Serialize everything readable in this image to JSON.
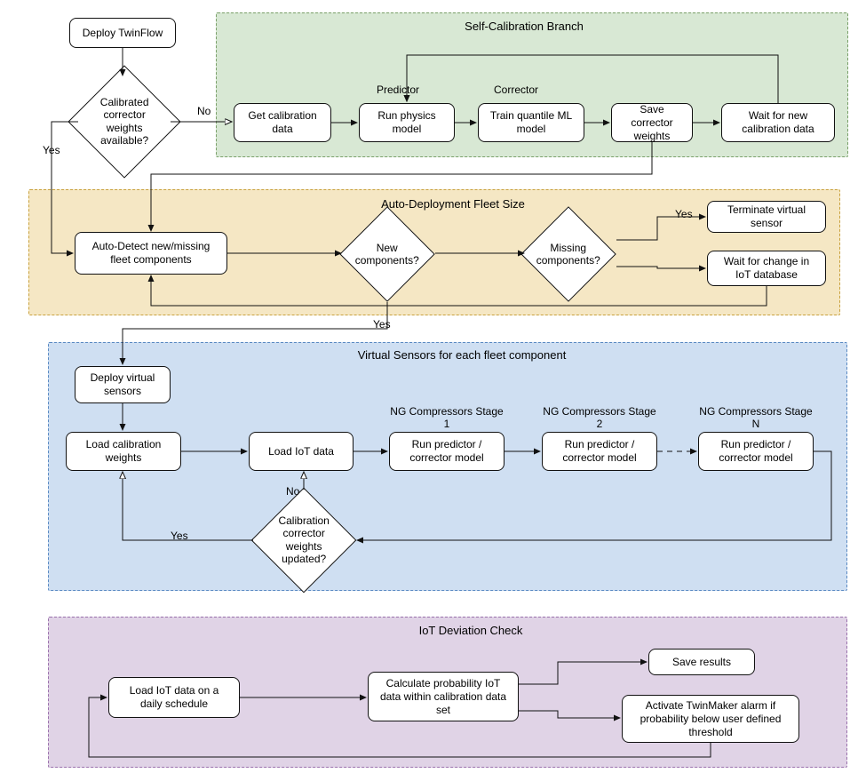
{
  "topflow": {
    "start": "Deploy TwinFlow",
    "decision": "Calibrated corrector weights available?",
    "yes_label": "Yes",
    "no_label": "No"
  },
  "green": {
    "title": "Self-Calibration Branch",
    "get_cal": "Get calibration data",
    "predictor_label": "Predictor",
    "run_phys": "Run physics model",
    "corrector_label": "Corrector",
    "train_ml": "Train quantile ML model",
    "save_w": "Save corrector weights",
    "wait_cal": "Wait for new calibration data"
  },
  "orange": {
    "title": "Auto-Deployment Fleet Size",
    "auto_detect": "Auto-Detect new/missing fleet components",
    "new_comp": "New components?",
    "miss_comp": "Missing components?",
    "terminate": "Terminate virtual sensor",
    "wait_change": "Wait for change in IoT database",
    "yes1": "Yes",
    "yes2": "Yes"
  },
  "blue": {
    "title": "Virtual Sensors for each fleet component",
    "deploy_vs": "Deploy virtual sensors",
    "load_cal": "Load calibration weights",
    "load_iot": "Load IoT data",
    "stage1_t": "NG Compressors Stage 1",
    "stage2_t": "NG Compressors Stage 2",
    "stageN_t": "NG Compressors Stage N",
    "run_pc": "Run predictor / corrector model",
    "cal_updated": "Calibration corrector weights updated?",
    "yes": "Yes",
    "no": "No"
  },
  "purple": {
    "title": "IoT Deviation Check",
    "load_iot_daily": "Load IoT data on a daily schedule",
    "calc_prob": "Calculate probability IoT data within calibration data set",
    "save_res": "Save results",
    "alarm": "Activate TwinMaker alarm if probability below user defined threshold"
  },
  "chart_data": {
    "type": "flowchart",
    "nodes": [
      {
        "id": "start",
        "kind": "process",
        "text": "Deploy TwinFlow",
        "region": null
      },
      {
        "id": "dec_cal",
        "kind": "decision",
        "text": "Calibrated corrector weights available?",
        "region": null
      },
      {
        "id": "g_get",
        "kind": "process",
        "text": "Get calibration data",
        "region": "Self-Calibration Branch"
      },
      {
        "id": "g_phys",
        "kind": "process",
        "text": "Run physics model",
        "annotation": "Predictor",
        "region": "Self-Calibration Branch"
      },
      {
        "id": "g_ml",
        "kind": "process",
        "text": "Train quantile ML model",
        "annotation": "Corrector",
        "region": "Self-Calibration Branch"
      },
      {
        "id": "g_save",
        "kind": "process",
        "text": "Save corrector weights",
        "region": "Self-Calibration Branch"
      },
      {
        "id": "g_wait",
        "kind": "process",
        "text": "Wait for new calibration data",
        "region": "Self-Calibration Branch"
      },
      {
        "id": "o_detect",
        "kind": "process",
        "text": "Auto-Detect new/missing fleet components",
        "region": "Auto-Deployment Fleet Size"
      },
      {
        "id": "o_new",
        "kind": "decision",
        "text": "New components?",
        "region": "Auto-Deployment Fleet Size"
      },
      {
        "id": "o_miss",
        "kind": "decision",
        "text": "Missing components?",
        "region": "Auto-Deployment Fleet Size"
      },
      {
        "id": "o_term",
        "kind": "process",
        "text": "Terminate virtual sensor",
        "region": "Auto-Deployment Fleet Size"
      },
      {
        "id": "o_wait",
        "kind": "process",
        "text": "Wait for change in IoT database",
        "region": "Auto-Deployment Fleet Size"
      },
      {
        "id": "b_deploy",
        "kind": "process",
        "text": "Deploy virtual sensors",
        "region": "Virtual Sensors for each fleet component"
      },
      {
        "id": "b_loadcal",
        "kind": "process",
        "text": "Load calibration weights",
        "region": "Virtual Sensors for each fleet component"
      },
      {
        "id": "b_loadiot",
        "kind": "process",
        "text": "Load IoT data",
        "region": "Virtual Sensors for each fleet component"
      },
      {
        "id": "b_s1",
        "kind": "process",
        "text": "Run predictor / corrector model",
        "annotation": "NG Compressors Stage 1",
        "region": "Virtual Sensors for each fleet component"
      },
      {
        "id": "b_s2",
        "kind": "process",
        "text": "Run predictor / corrector model",
        "annotation": "NG Compressors Stage 2",
        "region": "Virtual Sensors for each fleet component"
      },
      {
        "id": "b_sN",
        "kind": "process",
        "text": "Run predictor / corrector model",
        "annotation": "NG Compressors Stage N",
        "region": "Virtual Sensors for each fleet component"
      },
      {
        "id": "b_dec",
        "kind": "decision",
        "text": "Calibration corrector weights updated?",
        "region": "Virtual Sensors for each fleet component"
      },
      {
        "id": "p_load",
        "kind": "process",
        "text": "Load IoT data on a daily schedule",
        "region": "IoT Deviation Check"
      },
      {
        "id": "p_calc",
        "kind": "process",
        "text": "Calculate probability IoT data within calibration data set",
        "region": "IoT Deviation Check"
      },
      {
        "id": "p_save",
        "kind": "process",
        "text": "Save results",
        "region": "IoT Deviation Check"
      },
      {
        "id": "p_alarm",
        "kind": "process",
        "text": "Activate TwinMaker alarm if probability below user defined threshold",
        "region": "IoT Deviation Check"
      }
    ],
    "edges": [
      {
        "from": "start",
        "to": "dec_cal"
      },
      {
        "from": "dec_cal",
        "to": "g_get",
        "label": "No"
      },
      {
        "from": "dec_cal",
        "to": "o_detect",
        "label": "Yes"
      },
      {
        "from": "g_get",
        "to": "g_phys"
      },
      {
        "from": "g_phys",
        "to": "g_ml"
      },
      {
        "from": "g_ml",
        "to": "g_save"
      },
      {
        "from": "g_save",
        "to": "g_wait"
      },
      {
        "from": "g_wait",
        "to": "g_phys"
      },
      {
        "from": "g_save",
        "to": "o_detect"
      },
      {
        "from": "o_detect",
        "to": "o_new"
      },
      {
        "from": "o_new",
        "to": "o_miss"
      },
      {
        "from": "o_new",
        "to": "b_deploy",
        "label": "Yes"
      },
      {
        "from": "o_miss",
        "to": "o_term",
        "label": "Yes"
      },
      {
        "from": "o_miss",
        "to": "o_wait"
      },
      {
        "from": "o_wait",
        "to": "o_detect"
      },
      {
        "from": "b_deploy",
        "to": "b_loadcal"
      },
      {
        "from": "b_loadcal",
        "to": "b_loadiot"
      },
      {
        "from": "b_loadiot",
        "to": "b_s1"
      },
      {
        "from": "b_s1",
        "to": "b_s2"
      },
      {
        "from": "b_s2",
        "to": "b_sN"
      },
      {
        "from": "b_sN",
        "to": "b_dec"
      },
      {
        "from": "b_dec",
        "to": "b_loadcal",
        "label": "Yes"
      },
      {
        "from": "b_dec",
        "to": "b_loadiot",
        "label": "No"
      },
      {
        "from": "p_load",
        "to": "p_calc"
      },
      {
        "from": "p_calc",
        "to": "p_save"
      },
      {
        "from": "p_calc",
        "to": "p_alarm"
      },
      {
        "from": "p_alarm",
        "to": "p_load"
      }
    ],
    "regions": [
      {
        "name": "Self-Calibration Branch",
        "color": "#d8e8d4"
      },
      {
        "name": "Auto-Deployment Fleet Size",
        "color": "#f5e7c4"
      },
      {
        "name": "Virtual Sensors for each fleet component",
        "color": "#cfdff2"
      },
      {
        "name": "IoT Deviation Check",
        "color": "#e0d3e6"
      }
    ]
  }
}
